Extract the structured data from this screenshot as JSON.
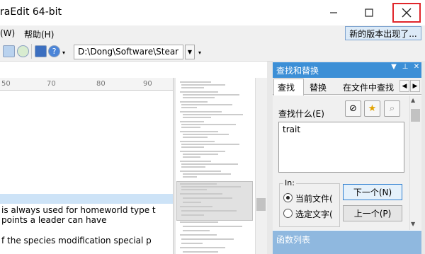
{
  "window": {
    "title": "raEdit 64-bit",
    "minimize_glyph": "—",
    "maximize_glyph": "☐",
    "close_glyph": "✕"
  },
  "menu": {
    "items": [
      "(W)",
      "帮助(H)"
    ]
  },
  "update_notice": "新的版本出现了...",
  "toolbar": {
    "path": "D:\\Dong\\Software\\Stear",
    "icons": [
      "view-icon",
      "refresh-icon",
      "list-icon",
      "help-icon"
    ]
  },
  "ruler": {
    "ticks": [
      "50",
      "70",
      "80",
      "90"
    ]
  },
  "editor": {
    "lines": [
      "is always used for homeworld type t",
      "points a leader can have",
      "",
      "f the species modification special p"
    ]
  },
  "find_panel": {
    "title": "查找和替换",
    "tabs": [
      "查找",
      "替换",
      "在文件中查找"
    ],
    "find_label": "查找什么(E)",
    "find_value": "trait",
    "in_label": "In:",
    "scope_options": [
      "当前文件(",
      "选定文字("
    ],
    "scope_selected": 0,
    "next_button": "下一个(N)",
    "prev_button": "上一个(P)"
  },
  "function_list": {
    "title": "函数列表"
  },
  "colors": {
    "accent": "#3c8fd6",
    "close_highlight": "#e0262b",
    "selection": "#cde3f7"
  }
}
